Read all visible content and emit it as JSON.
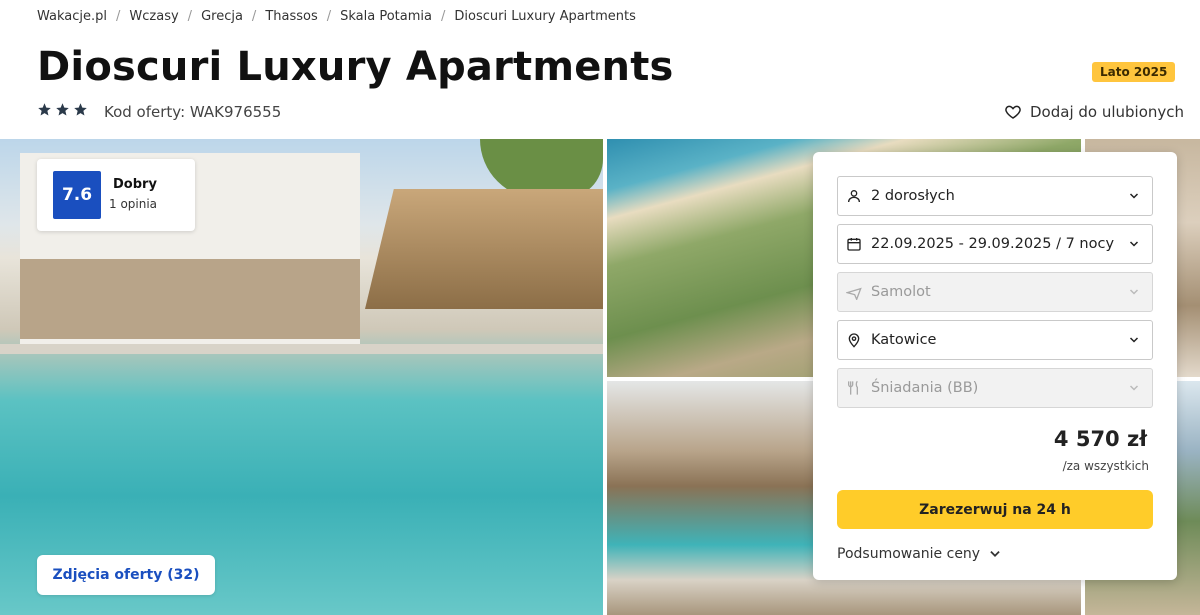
{
  "breadcrumb": [
    "Wakacje.pl",
    "Wczasy",
    "Grecja",
    "Thassos",
    "Skala Potamia",
    "Dioscuri Luxury Apartments"
  ],
  "title": "Dioscuri Luxury Apartments",
  "season_badge": "Lato 2025",
  "stars": 3,
  "offer_code": "Kod oferty: WAK976555",
  "favorite_label": "Dodaj do ulubionych",
  "rating": {
    "score": "7.6",
    "label": "Dobry",
    "count": "1 opinia"
  },
  "photos_button": "Zdjęcia oferty (32)",
  "booking": {
    "travelers": "2 dorosłych",
    "dates": "22.09.2025 - 29.09.2025 / 7 nocy",
    "transport": "Samolot",
    "departure": "Katowice",
    "board": "Śniadania (BB)",
    "price": "4 570 zł",
    "price_note": "/za wszystkich",
    "book_button": "Zarezerwuj na 24 h",
    "summary": "Podsumowanie ceny"
  },
  "colors": {
    "accent_blue": "#1a4fbf",
    "cta_yellow": "#ffcc29",
    "badge_yellow": "#ffc53d"
  }
}
